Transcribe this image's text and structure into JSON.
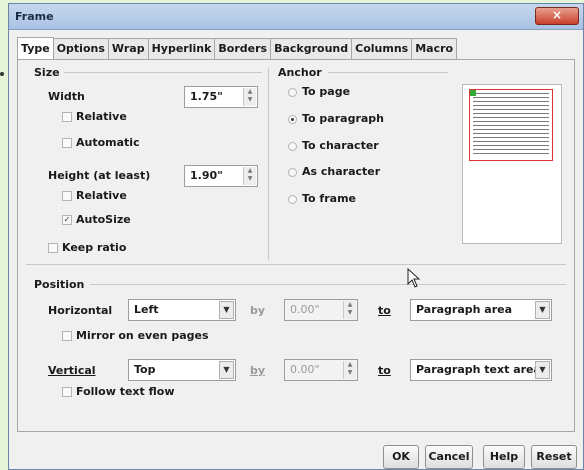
{
  "window": {
    "title": "Frame",
    "close_label": "×"
  },
  "tabs": [
    "Type",
    "Options",
    "Wrap",
    "Hyperlink",
    "Borders",
    "Background",
    "Columns",
    "Macro"
  ],
  "size": {
    "heading": "Size",
    "width_label": "Width",
    "width_value": "1.75\"",
    "width_relative": "Relative",
    "width_automatic": "Automatic",
    "height_label": "Height (at least)",
    "height_value": "1.90\"",
    "height_relative": "Relative",
    "height_autosize": "AutoSize",
    "keep_ratio": "Keep ratio"
  },
  "anchor": {
    "heading": "Anchor",
    "options": [
      "To page",
      "To paragraph",
      "To character",
      "As character",
      "To frame"
    ],
    "selected": "To paragraph"
  },
  "position": {
    "heading": "Position",
    "horizontal_label": "Horizontal",
    "horizontal_value": "Left",
    "horizontal_by_label": "by",
    "horizontal_by_value": "0.00\"",
    "horizontal_to_label": "to",
    "horizontal_to_value": "Paragraph area",
    "mirror_label": "Mirror on even pages",
    "vertical_label": "Vertical",
    "vertical_value": "Top",
    "vertical_by_label": "by",
    "vertical_by_value": "0.00\"",
    "vertical_to_label": "to",
    "vertical_to_value": "Paragraph text area",
    "follow_label": "Follow text flow"
  },
  "buttons": {
    "ok": "OK",
    "cancel": "Cancel",
    "help": "Help",
    "reset": "Reset"
  },
  "colors": {
    "anchor_border": "#dd3333",
    "title_bar": "#b5cbe8",
    "page_bg": "#e6f5d8"
  }
}
